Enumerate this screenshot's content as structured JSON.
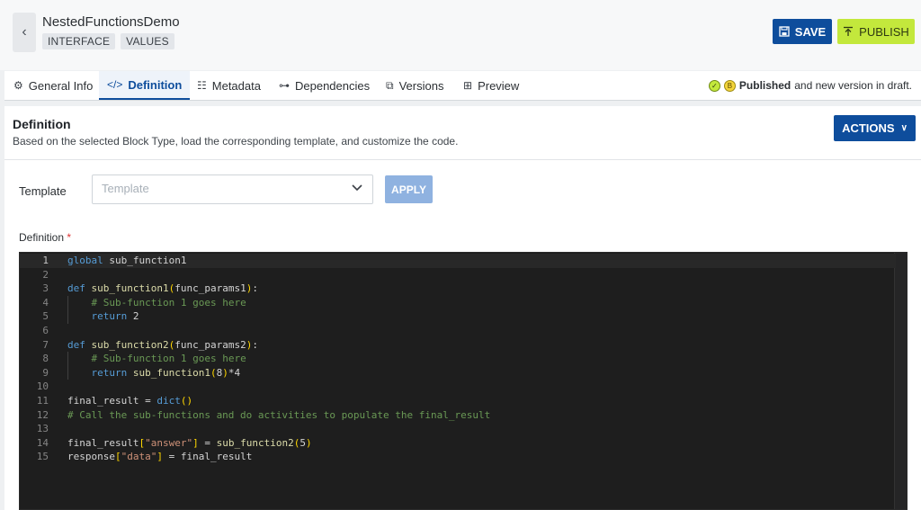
{
  "header": {
    "title": "NestedFunctionsDemo",
    "tags": [
      "INTERFACE",
      "VALUES"
    ],
    "save_label": "SAVE",
    "publish_label": "PUBLISH"
  },
  "tabs": [
    {
      "label": "General Info",
      "icon": "gear-icon"
    },
    {
      "label": "Definition",
      "icon": "code-icon",
      "active": true
    },
    {
      "label": "Metadata",
      "icon": "list-icon"
    },
    {
      "label": "Dependencies",
      "icon": "tree-icon"
    },
    {
      "label": "Versions",
      "icon": "copy-icon"
    },
    {
      "label": "Preview",
      "icon": "preview-icon"
    }
  ],
  "status": {
    "published_bold": "Published",
    "rest": "and new version in draft."
  },
  "section": {
    "title": "Definition",
    "description": "Based on the selected Block Type, load the corresponding template, and customize the code.",
    "actions_label": "ACTIONS"
  },
  "template": {
    "label": "Template",
    "placeholder": "Template",
    "apply_label": "APPLY"
  },
  "definition": {
    "label": "Definition",
    "required_mark": "*"
  },
  "code_lines": [
    "global sub_function1",
    "",
    "def sub_function1(func_params1):",
    "    # Sub-function 1 goes here",
    "    return 2",
    "",
    "def sub_function2(func_params2):",
    "    # Sub-function 1 goes here",
    "    return sub_function1(8)*4",
    "",
    "final_result = dict()",
    "# Call the sub-functions and do activities to populate the final_result",
    "",
    "final_result[\"answer\"] = sub_function2(5)",
    "response[\"data\"] = final_result"
  ],
  "colors": {
    "primary": "#0e4d9c",
    "publish": "#c3e83c",
    "editor_bg": "#1e1e1e"
  }
}
